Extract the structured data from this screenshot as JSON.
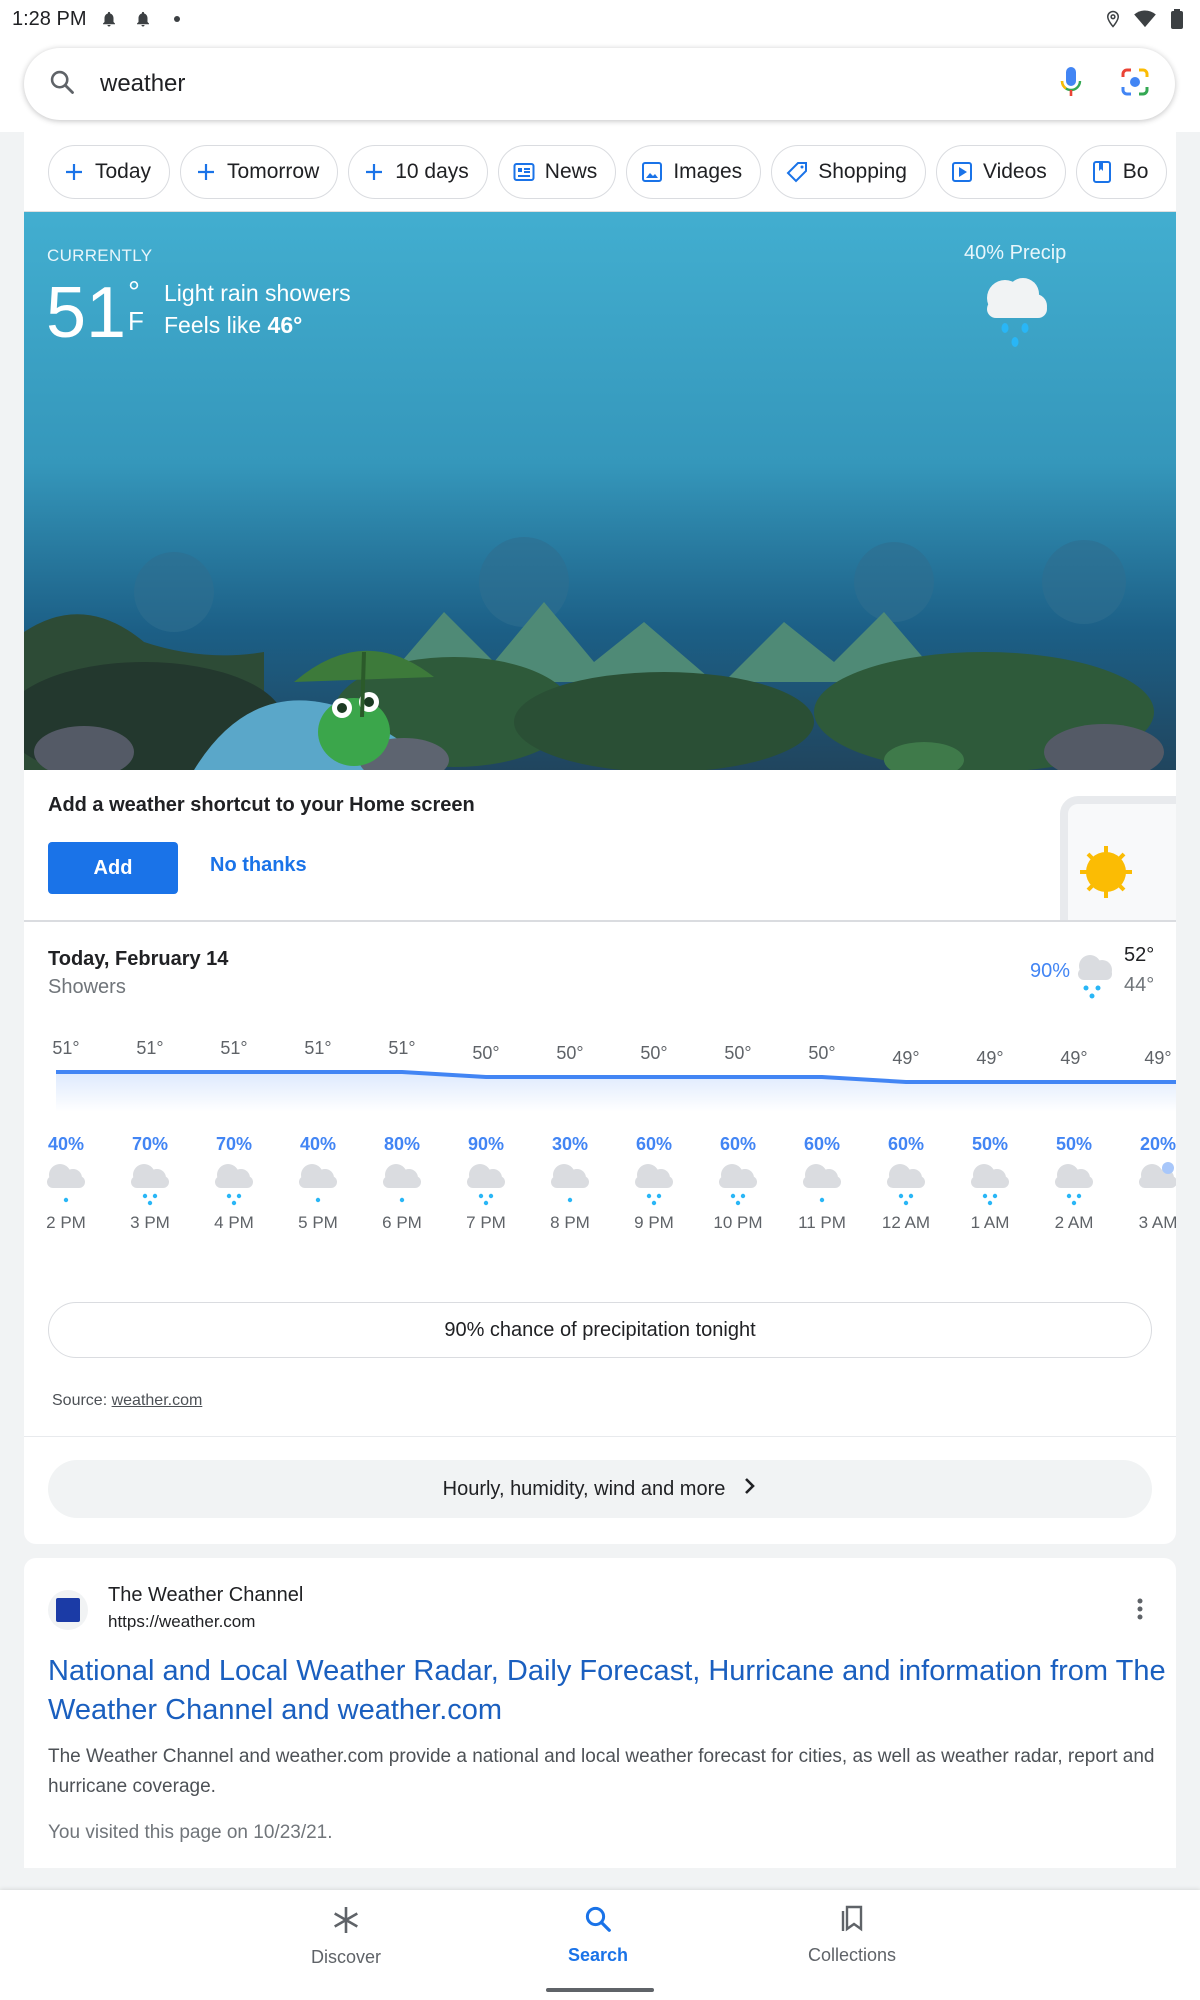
{
  "status": {
    "time": "1:28 PM"
  },
  "search": {
    "query": "weather"
  },
  "chips": [
    {
      "label": "Today",
      "icon": "plus-icon"
    },
    {
      "label": "Tomorrow",
      "icon": "plus-icon"
    },
    {
      "label": "10 days",
      "icon": "plus-icon"
    },
    {
      "label": "News",
      "icon": "news-icon"
    },
    {
      "label": "Images",
      "icon": "image-icon"
    },
    {
      "label": "Shopping",
      "icon": "tag-icon"
    },
    {
      "label": "Videos",
      "icon": "video-icon"
    },
    {
      "label": "Bo",
      "icon": "book-icon"
    }
  ],
  "current": {
    "label": "CURRENTLY",
    "temp": "51",
    "deg": "°",
    "unit": "F",
    "description": "Light rain showers",
    "feels_prefix": "Feels like",
    "feels_value": "46°",
    "precip": "40% Precip"
  },
  "shortcut": {
    "title": "Add a weather shortcut to your Home screen",
    "add": "Add",
    "no": "No thanks"
  },
  "daily": {
    "date": "Today, February 14",
    "condition": "Showers",
    "precip": "90%",
    "high": "52°",
    "low": "44°"
  },
  "hourly": [
    {
      "time": "2 PM",
      "temp": 51,
      "precip": "40%",
      "icon": "light-rain"
    },
    {
      "time": "3 PM",
      "temp": 51,
      "precip": "70%",
      "icon": "rain"
    },
    {
      "time": "4 PM",
      "temp": 51,
      "precip": "70%",
      "icon": "rain"
    },
    {
      "time": "5 PM",
      "temp": 51,
      "precip": "40%",
      "icon": "light-rain"
    },
    {
      "time": "6 PM",
      "temp": 51,
      "precip": "80%",
      "icon": "light-rain"
    },
    {
      "time": "7 PM",
      "temp": 50,
      "precip": "90%",
      "icon": "rain"
    },
    {
      "time": "8 PM",
      "temp": 50,
      "precip": "30%",
      "icon": "light-rain"
    },
    {
      "time": "9 PM",
      "temp": 50,
      "precip": "60%",
      "icon": "rain"
    },
    {
      "time": "10 PM",
      "temp": 50,
      "precip": "60%",
      "icon": "rain"
    },
    {
      "time": "11 PM",
      "temp": 50,
      "precip": "60%",
      "icon": "light-rain"
    },
    {
      "time": "12 AM",
      "temp": 49,
      "precip": "60%",
      "icon": "rain"
    },
    {
      "time": "1 AM",
      "temp": 49,
      "precip": "50%",
      "icon": "rain"
    },
    {
      "time": "2 AM",
      "temp": 49,
      "precip": "50%",
      "icon": "rain"
    },
    {
      "time": "3 AM",
      "temp": 49,
      "precip": "20%",
      "icon": "partly-cloudy-night"
    }
  ],
  "precip_tonight": "90% chance of precipitation tonight",
  "source": {
    "prefix": "Source:",
    "link": "weather.com"
  },
  "more": "Hourly, humidity, wind and more",
  "result": {
    "site": "The Weather Channel",
    "url": "https://weather.com",
    "title": "National and Local Weather Radar, Daily Forecast, Hurricane and information from The Weather Channel and weather.com",
    "snippet": "The Weather Channel and weather.com provide a national and local weather forecast for cities, as well as weather radar, report and hurricane coverage.",
    "visited": "You visited this page on 10/23/21."
  },
  "nav": [
    {
      "label": "Discover",
      "icon": "asterisk-icon"
    },
    {
      "label": "Search",
      "icon": "search-icon"
    },
    {
      "label": "Collections",
      "icon": "bookmarks-icon"
    }
  ],
  "colors": {
    "accent": "#1a73e8",
    "precip": "#4285f4",
    "sky": "#42aed0"
  }
}
